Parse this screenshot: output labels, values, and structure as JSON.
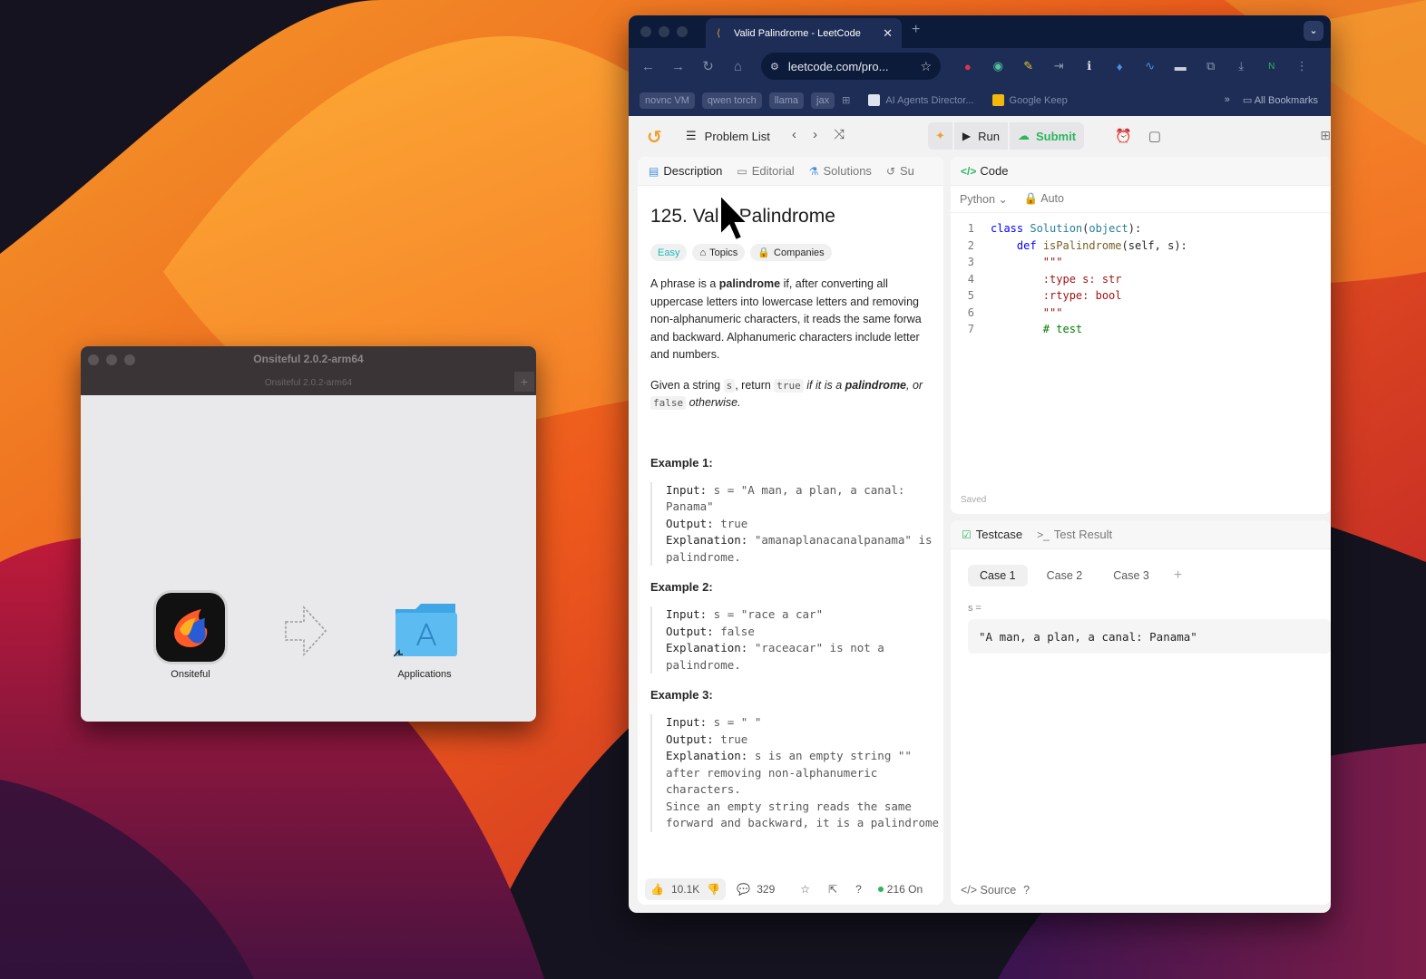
{
  "installer": {
    "title": "Onsiteful 2.0.2-arm64",
    "subtitle": "Onsiteful 2.0.2-arm64",
    "app_label": "Onsiteful",
    "folder_label": "Applications",
    "add_icon": "+"
  },
  "browser": {
    "tab_title": "Valid Palindrome - LeetCode",
    "tab_close": "✕",
    "new_tab": "+",
    "tab_menu": "⌄",
    "url": "leetcode.com/pro...",
    "bookmarks": [
      "novnc VM",
      "qwen torch",
      "llama",
      "jax"
    ],
    "bookmark_links": [
      "AI Agents Director...",
      "Google Keep"
    ],
    "all_bookmarks": "All Bookmarks",
    "bm_more": "»"
  },
  "lc": {
    "problem_list": "Problem List",
    "run": "Run",
    "submit": "Submit",
    "tabs": [
      "Description",
      "Editorial",
      "Solutions",
      "Su"
    ],
    "title": "125. Valid Palindrome",
    "difficulty": "Easy",
    "topics": "Topics",
    "companies": "Companies",
    "desc_p1_a": "A phrase is a ",
    "desc_p1_b": "palindrome",
    "desc_p1_c": " if, after converting all",
    "desc_p1_l2": "uppercase letters into lowercase letters and removing",
    "desc_p1_l3": "non-alphanumeric characters, it reads the same forwa",
    "desc_p1_l4": "and backward. Alphanumeric characters include letter",
    "desc_p1_l5": "and numbers.",
    "desc_p2_a": "Given a string ",
    "desc_p2_s": "s",
    "desc_p2_b": ", return ",
    "desc_p2_true": "true",
    "desc_p2_c": " if it is a ",
    "desc_p2_d": "palindrome",
    "desc_p2_e": ", or",
    "desc_p2_false": "false",
    "desc_p2_f": " otherwise.",
    "examples": [
      {
        "title": "Example 1:",
        "lines": [
          [
            "Input:",
            " s = \"A man, a plan, a canal:"
          ],
          [
            "",
            "Panama\""
          ],
          [
            "Output:",
            " true"
          ],
          [
            "Explanation:",
            " \"amanaplanacanalpanama\" is"
          ],
          [
            "",
            "palindrome."
          ]
        ]
      },
      {
        "title": "Example 2:",
        "lines": [
          [
            "Input:",
            " s = \"race a car\""
          ],
          [
            "Output:",
            " false"
          ],
          [
            "Explanation:",
            " \"raceacar\" is not a"
          ],
          [
            "",
            "palindrome."
          ]
        ]
      },
      {
        "title": "Example 3:",
        "lines": [
          [
            "Input:",
            " s = \" \""
          ],
          [
            "Output:",
            " true"
          ],
          [
            "Explanation:",
            " s is an empty string \"\""
          ],
          [
            "",
            "after removing non-alphanumeric"
          ],
          [
            "",
            "characters."
          ],
          [
            "",
            "Since an empty string reads the same"
          ],
          [
            "",
            "forward and backward, it is a palindrome"
          ]
        ]
      }
    ],
    "likes": "10.1K",
    "comments": "329",
    "online": "216 On",
    "code_tab": "Code",
    "language": "Python",
    "auto": "Auto",
    "code_lines": [
      "class Solution(object):",
      "    def isPalindrome(self, s):",
      "        \"\"\"",
      "        :type s: str",
      "        :rtype: bool",
      "        \"\"\"",
      "        # test"
    ],
    "saved": "Saved",
    "testcase_tab": "Testcase",
    "test_result_tab": "Test Result",
    "cases": [
      "Case 1",
      "Case 2",
      "Case 3"
    ],
    "s_label": "s =",
    "s_value": "\"A man, a plan, a canal: Panama\"",
    "source": "Source"
  },
  "colors": {
    "browser_frame": "#1d2d55",
    "tabstrip": "#0d1b3a",
    "submit_green": "#2db55d",
    "easy_teal": "#1cbaba",
    "leetcode_orange": "#f0a030"
  }
}
